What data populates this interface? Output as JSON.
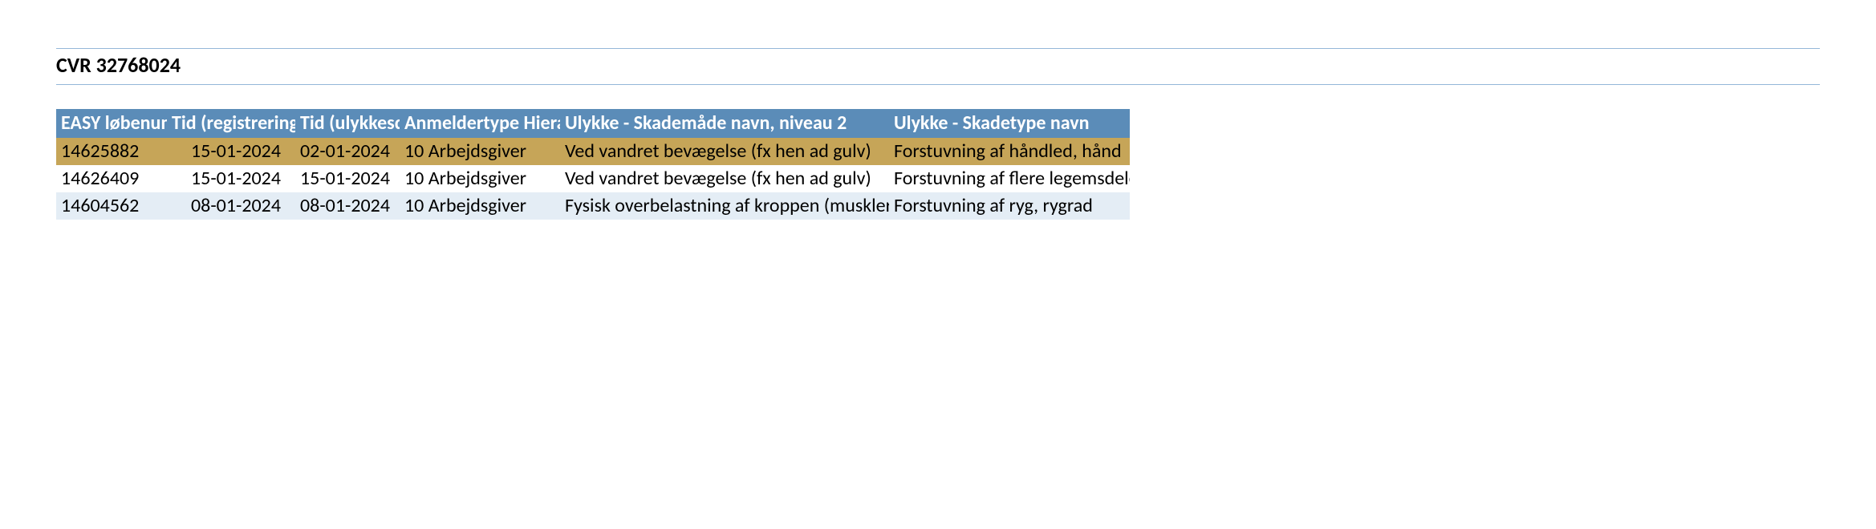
{
  "title": "CVR 32768024",
  "table": {
    "headers": [
      "EASY løbenummer",
      "Tid (registreringsdato)",
      "Tid (ulykkesdato)",
      "Anmeldertype Hierarki",
      "Ulykke - Skademåde navn, niveau 2",
      "Ulykke - Skadetype navn"
    ],
    "rows": [
      {
        "id": "14625882",
        "reg_date": "15-01-2024",
        "acc_date": "02-01-2024",
        "reporter": "10 Arbejdsgiver",
        "injury_mode": "Ved vandret bevægelse (fx hen ad gulv)",
        "injury_type": "Forstuvning af håndled, hånd",
        "highlight": true
      },
      {
        "id": "14626409",
        "reg_date": "15-01-2024",
        "acc_date": "15-01-2024",
        "reporter": "10 Arbejdsgiver",
        "injury_mode": "Ved vandret bevægelse (fx hen ad gulv)",
        "injury_type": "Forstuvning af flere legemsdele",
        "highlight": false
      },
      {
        "id": "14604562",
        "reg_date": "08-01-2024",
        "acc_date": "08-01-2024",
        "reporter": "10 Arbejdsgiver",
        "injury_mode": "Fysisk overbelastning af kroppen (muskler, kr",
        "injury_type": "Forstuvning af ryg, rygrad",
        "highlight": false
      }
    ]
  }
}
